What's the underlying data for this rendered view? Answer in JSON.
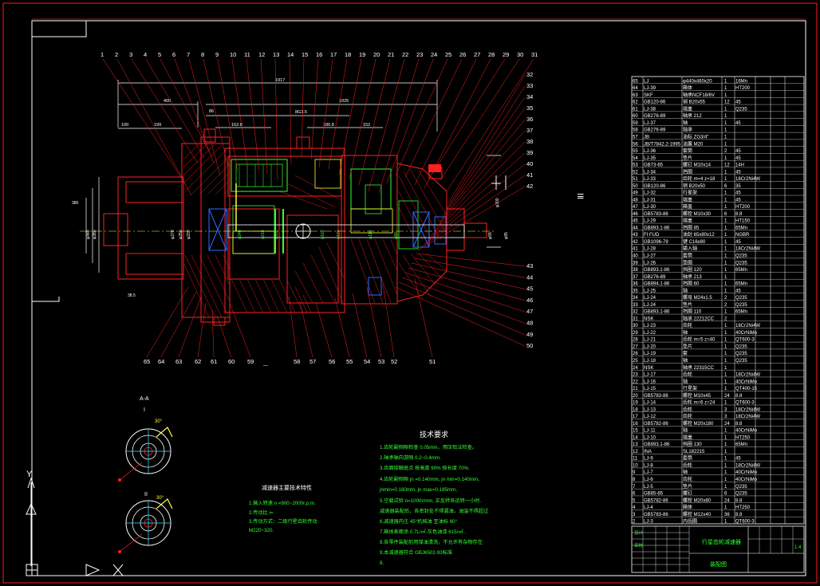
{
  "colors": {
    "background": "#000000",
    "frame_red": "#d81818",
    "drawing_red": "#ff2020",
    "white": "#ffffff",
    "green": "#33ff33",
    "yellow": "#ffff33",
    "cyan": "#33e6ff",
    "blue": "#2a6cff",
    "magenta": "#ff33ff"
  },
  "balloons_top": [
    "1",
    "2",
    "3",
    "4",
    "5",
    "6",
    "7",
    "8",
    "9",
    "10",
    "11",
    "12",
    "13",
    "14",
    "15",
    "16",
    "17",
    "18",
    "19",
    "20",
    "21",
    "22",
    "23",
    "24",
    "25",
    "26",
    "27",
    "28",
    "29",
    "30",
    "31"
  ],
  "balloons_right": [
    "32",
    "33",
    "34",
    "35",
    "36",
    "37",
    "38",
    "39",
    "40",
    "41",
    "42",
    "43",
    "44",
    "45",
    "46",
    "47",
    "48",
    "49",
    "50"
  ],
  "balloons_bottom": [
    "65",
    "64",
    "63",
    "62",
    "61",
    "60",
    "59",
    "58",
    "57",
    "56",
    "55",
    "54",
    "53",
    "52",
    "51"
  ],
  "dimensions": [
    "1917",
    "400",
    "1025",
    "8G3.5",
    "162.8",
    "199",
    "100",
    "86",
    "186.8",
    "152"
  ],
  "section_label": "A-A",
  "detail_labels": [
    "I",
    "II"
  ],
  "detail_angle": "30°",
  "tech_title": "技术要求",
  "tech_lines": [
    "1.齿轮副侧隙检查 0.05mm，用压铅法检查。",
    "2.轴承轴向游隙 0.2~0.4mm.",
    "3.齿面接触斑点 按高度 90% 按长度 70%.",
    "4.齿轮副侧隙 jn      =0.140mm, jn min=0.140mm,",
    "   jnmin=0.180mm, jn max=0.185mm,",
    "5.空载试验 n=1000r/min, 正反转各运转一小时.",
    "  减速器装配后，各密封处不得漏油，油温不得超过",
    "6.减速器内注 45°机械油 至油标 60°",
    "7.箱体表面涂 0.7L/㎡-灰色油漆 615/㎡ .",
    "8.各零件装配前用煤油清洗，不允许有杂物存在",
    "9.本减速器符合 GBJ6502-93标准",
    "8."
  ],
  "perf_title": "减速器主要技术特性",
  "perf_lines": [
    "1.输入转速   n   =900~2000r.p.m.",
    "2.传动比 i=",
    "3.传动方式：二级行星齿轮传动",
    "   M220~320."
  ],
  "side_mark": "ⅠⅡ",
  "bom": {
    "rows": [
      {
        "no": "65",
        "code": "LJ",
        "name": "φ440x460x20",
        "qty": "1",
        "mat": "16Mn"
      },
      {
        "no": "64",
        "code": "LJ-39",
        "name": "箱体",
        "qty": "1",
        "mat": "HT200"
      },
      {
        "no": "63",
        "code": "SKF",
        "name": "轴承NCF18/6V",
        "qty": "1",
        "mat": ""
      },
      {
        "no": "62",
        "code": "GB120-86",
        "name": "销 B20x55",
        "qty": "12",
        "mat": "45"
      },
      {
        "no": "61",
        "code": "LJ-38",
        "name": "端盖",
        "qty": "1",
        "mat": "Q235"
      },
      {
        "no": "60",
        "code": "GB276-89",
        "name": "轴承 212",
        "qty": "1",
        "mat": ""
      },
      {
        "no": "59",
        "code": "LJ-37",
        "name": "轴",
        "qty": "1",
        "mat": "45"
      },
      {
        "no": "58",
        "code": "GB276-89",
        "name": "轴承",
        "qty": "1",
        "mat": ""
      },
      {
        "no": "57",
        "code": "JB",
        "name": "油标 ZG3/4\"",
        "qty": "1",
        "mat": ""
      },
      {
        "no": "56",
        "code": "JB/T7842.2-1995",
        "name": "油塞 M20",
        "qty": "1",
        "mat": ""
      },
      {
        "no": "55",
        "code": "LJ-36",
        "name": "套筒",
        "qty": "2",
        "mat": "45"
      },
      {
        "no": "54",
        "code": "LJ-35",
        "name": "垫片",
        "qty": "1",
        "mat": "45"
      },
      {
        "no": "53",
        "code": "GB73-85",
        "name": "螺钉 M10x14",
        "qty": "12",
        "mat": "14H"
      },
      {
        "no": "52",
        "code": "LJ-34",
        "name": "挡圈",
        "qty": "1",
        "mat": "45"
      },
      {
        "no": "51",
        "code": "LJ-33",
        "name": "齿轮 m=4 z=18",
        "qty": "1",
        "mat": "18Cr2Ni4W"
      },
      {
        "no": "50",
        "code": "GB120-86",
        "name": "销 B20x50",
        "qty": "6",
        "mat": "35"
      },
      {
        "no": "49",
        "code": "LJ-32",
        "name": "行星架",
        "qty": "1",
        "mat": "45"
      },
      {
        "no": "48",
        "code": "LJ-31",
        "name": "端盖",
        "qty": "1",
        "mat": "45"
      },
      {
        "no": "47",
        "code": "LJ-30",
        "name": "箱盖",
        "qty": "1",
        "mat": "HT200"
      },
      {
        "no": "46",
        "code": "GB5783-86",
        "name": "螺栓 M10x30",
        "qty": "6",
        "mat": "8.8"
      },
      {
        "no": "45",
        "code": "LJ-29",
        "name": "端盖",
        "qty": "1",
        "mat": "HT150"
      },
      {
        "no": "44",
        "code": "GB893.1-86",
        "name": "挡圈 85",
        "qty": "1",
        "mat": "65Mn"
      },
      {
        "no": "43",
        "code": "FI FUD",
        "name": "油封 65x80x12",
        "qty": "1",
        "mat": "NGBR"
      },
      {
        "no": "42",
        "code": "GB1096-79",
        "name": "键 C16x80",
        "qty": "1",
        "mat": "45"
      },
      {
        "no": "41",
        "code": "LJ-28",
        "name": "输入轴",
        "qty": "1",
        "mat": "18Cr2Ni4W"
      },
      {
        "no": "40",
        "code": "LJ-27",
        "name": "套筒",
        "qty": "1",
        "mat": "Q235"
      },
      {
        "no": "39",
        "code": "LJ-26",
        "name": "垫圈",
        "qty": "1",
        "mat": "Q235"
      },
      {
        "no": "38",
        "code": "GB893.1-86",
        "name": "挡圈 120",
        "qty": "1",
        "mat": "65Mn"
      },
      {
        "no": "37",
        "code": "GB276-89",
        "name": "轴承 213",
        "qty": "1",
        "mat": ""
      },
      {
        "no": "36",
        "code": "GB894.1-86",
        "name": "挡圈 60",
        "qty": "1",
        "mat": "65Mn"
      },
      {
        "no": "35",
        "code": "LJ-25",
        "name": "轴",
        "qty": "1",
        "mat": "45"
      },
      {
        "no": "34",
        "code": "LJ-24",
        "name": "螺母 M24x1.5",
        "qty": "2",
        "mat": "Q235"
      },
      {
        "no": "33",
        "code": "LJ-24",
        "name": "垫片",
        "qty": "2",
        "mat": "Q235"
      },
      {
        "no": "32",
        "code": "GB893.1-86",
        "name": "挡圈 110",
        "qty": "1",
        "mat": "65Mn"
      },
      {
        "no": "31",
        "code": "NSK",
        "name": "轴承 22212CC",
        "qty": "2",
        "mat": ""
      },
      {
        "no": "30",
        "code": "LJ-23",
        "name": "齿轮",
        "qty": "1",
        "mat": "18Cr2Ni4W"
      },
      {
        "no": "29",
        "code": "LJ-22",
        "name": "轴",
        "qty": "1",
        "mat": "40CrNiMo"
      },
      {
        "no": "28",
        "code": "LJ-21",
        "name": "齿轮 m=5 z=40",
        "qty": "1",
        "mat": "QT600-3"
      },
      {
        "no": "27",
        "code": "LJ-20",
        "name": "垫片",
        "qty": "1",
        "mat": "Q235"
      },
      {
        "no": "26",
        "code": "LJ-19",
        "name": "套",
        "qty": "1",
        "mat": "Q235"
      },
      {
        "no": "25",
        "code": "LJ-18",
        "name": "轴",
        "qty": "1",
        "mat": "Q235"
      },
      {
        "no": "24",
        "code": "NSK",
        "name": "轴承 22315CC",
        "qty": "1",
        "mat": ""
      },
      {
        "no": "23",
        "code": "LJ-17",
        "name": "齿轮",
        "qty": "1",
        "mat": "18Cr2Ni4W"
      },
      {
        "no": "22",
        "code": "LJ-16",
        "name": "轴",
        "qty": "1",
        "mat": "40CrNiMo"
      },
      {
        "no": "21",
        "code": "LJ-15",
        "name": "行星架",
        "qty": "1",
        "mat": "QT400-15"
      },
      {
        "no": "20",
        "code": "GB5783-86",
        "name": "螺栓 M10x45",
        "qty": "24",
        "mat": "8.8"
      },
      {
        "no": "19",
        "code": "LJ-14",
        "name": "齿轮 m=6 z=24",
        "qty": "1",
        "mat": "QT600-3"
      },
      {
        "no": "18",
        "code": "LJ-13",
        "name": "齿轮",
        "qty": "3",
        "mat": "18Cr2Ni4W"
      },
      {
        "no": "17",
        "code": "LJ-12",
        "name": "齿轮",
        "qty": "3",
        "mat": "18Cr2Ni4W"
      },
      {
        "no": "16",
        "code": "GB5782-86",
        "name": "螺栓 M20x180",
        "qty": "24",
        "mat": "8.8"
      },
      {
        "no": "15",
        "code": "LJ-11",
        "name": "轴",
        "qty": "1",
        "mat": "40CrNiMo"
      },
      {
        "no": "14",
        "code": "LJ-10",
        "name": "端盖",
        "qty": "1",
        "mat": "HT250"
      },
      {
        "no": "13",
        "code": "GB893.1-86",
        "name": "挡圈 130",
        "qty": "1",
        "mat": "65Mn"
      },
      {
        "no": "12",
        "code": "INA",
        "name": "SL182215",
        "qty": "1",
        "mat": ""
      },
      {
        "no": "11",
        "code": "LJ-9",
        "name": "套筒",
        "qty": "1",
        "mat": "45"
      },
      {
        "no": "10",
        "code": "LJ-8",
        "name": "齿轮",
        "qty": "1",
        "mat": "18Cr2Ni4W"
      },
      {
        "no": "9",
        "code": "LJ-7",
        "name": "轴",
        "qty": "1",
        "mat": "40CrNiMo"
      },
      {
        "no": "8",
        "code": "LJ-6",
        "name": "齿轮",
        "qty": "1",
        "mat": "40CrNiMo"
      },
      {
        "no": "7",
        "code": "LJ-5",
        "name": "垫片",
        "qty": "1",
        "mat": "Q235"
      },
      {
        "no": "6",
        "code": "GB85-85",
        "name": "螺钉",
        "qty": "6",
        "mat": "Q235"
      },
      {
        "no": "5",
        "code": "GB5782-86",
        "name": "螺栓 M20x80",
        "qty": "24",
        "mat": "8.8"
      },
      {
        "no": "4",
        "code": "LJ-4",
        "name": "箱体",
        "qty": "1",
        "mat": "HT250"
      },
      {
        "no": "3",
        "code": "GB5783-86",
        "name": "螺栓 M12x40",
        "qty": "36",
        "mat": "8.8"
      },
      {
        "no": "2",
        "code": "LJ-3",
        "name": "内齿圈",
        "qty": "1",
        "mat": "QT600-3"
      }
    ],
    "title_block": {
      "drawing_title": "行星齿轮减速器",
      "scale": "1:4",
      "sheet": "装配图",
      "designer": "设计",
      "checker": "审核"
    }
  }
}
